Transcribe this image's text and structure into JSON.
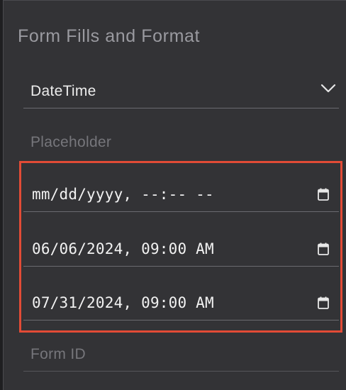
{
  "panel": {
    "title": "Form Fills and Format"
  },
  "format_select": {
    "selected": "DateTime",
    "icon": "chevron-down-icon"
  },
  "placeholder_field": {
    "placeholder": "Placeholder"
  },
  "datetime_fields": [
    {
      "value": "mm/dd/yyyy, --:-- --",
      "icon": "calendar-icon"
    },
    {
      "value": "06/06/2024, 09:00 AM",
      "icon": "calendar-icon"
    },
    {
      "value": "07/31/2024, 09:00 AM",
      "icon": "calendar-icon"
    }
  ],
  "form_id_field": {
    "placeholder": "Form ID"
  },
  "colors": {
    "panel_bg": "#333336",
    "highlight_border": "#e24b36",
    "text_primary": "#f2f2f2",
    "text_muted": "#76767b"
  }
}
